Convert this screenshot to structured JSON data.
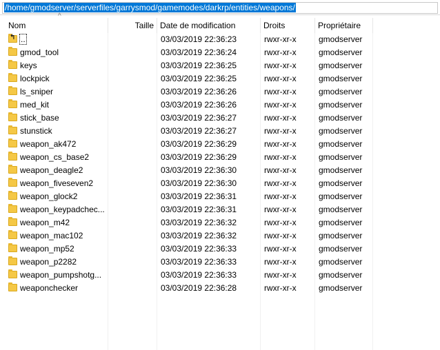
{
  "path_bar": {
    "value": "/home/gmodserver/serverfiles/garrysmod/gamemodes/darkrp/entities/weapons/"
  },
  "columns": {
    "name": "Nom",
    "size": "Taille",
    "date": "Date de modification",
    "permissions": "Droits",
    "owner": "Propriétaire"
  },
  "rows": [
    {
      "name": "..",
      "date": "03/03/2019 22:36:23",
      "permissions": "rwxr-xr-x",
      "owner": "gmodserver",
      "icon": "parent-folder-icon"
    },
    {
      "name": "gmod_tool",
      "date": "03/03/2019 22:36:24",
      "permissions": "rwxr-xr-x",
      "owner": "gmodserver",
      "icon": "folder-icon"
    },
    {
      "name": "keys",
      "date": "03/03/2019 22:36:25",
      "permissions": "rwxr-xr-x",
      "owner": "gmodserver",
      "icon": "folder-icon"
    },
    {
      "name": "lockpick",
      "date": "03/03/2019 22:36:25",
      "permissions": "rwxr-xr-x",
      "owner": "gmodserver",
      "icon": "folder-icon"
    },
    {
      "name": "ls_sniper",
      "date": "03/03/2019 22:36:26",
      "permissions": "rwxr-xr-x",
      "owner": "gmodserver",
      "icon": "folder-icon"
    },
    {
      "name": "med_kit",
      "date": "03/03/2019 22:36:26",
      "permissions": "rwxr-xr-x",
      "owner": "gmodserver",
      "icon": "folder-icon"
    },
    {
      "name": "stick_base",
      "date": "03/03/2019 22:36:27",
      "permissions": "rwxr-xr-x",
      "owner": "gmodserver",
      "icon": "folder-icon"
    },
    {
      "name": "stunstick",
      "date": "03/03/2019 22:36:27",
      "permissions": "rwxr-xr-x",
      "owner": "gmodserver",
      "icon": "folder-icon"
    },
    {
      "name": "weapon_ak472",
      "date": "03/03/2019 22:36:29",
      "permissions": "rwxr-xr-x",
      "owner": "gmodserver",
      "icon": "folder-icon"
    },
    {
      "name": "weapon_cs_base2",
      "date": "03/03/2019 22:36:29",
      "permissions": "rwxr-xr-x",
      "owner": "gmodserver",
      "icon": "folder-icon"
    },
    {
      "name": "weapon_deagle2",
      "date": "03/03/2019 22:36:30",
      "permissions": "rwxr-xr-x",
      "owner": "gmodserver",
      "icon": "folder-icon"
    },
    {
      "name": "weapon_fiveseven2",
      "date": "03/03/2019 22:36:30",
      "permissions": "rwxr-xr-x",
      "owner": "gmodserver",
      "icon": "folder-icon"
    },
    {
      "name": "weapon_glock2",
      "date": "03/03/2019 22:36:31",
      "permissions": "rwxr-xr-x",
      "owner": "gmodserver",
      "icon": "folder-icon"
    },
    {
      "name": "weapon_keypadchec...",
      "date": "03/03/2019 22:36:31",
      "permissions": "rwxr-xr-x",
      "owner": "gmodserver",
      "icon": "folder-icon"
    },
    {
      "name": "weapon_m42",
      "date": "03/03/2019 22:36:32",
      "permissions": "rwxr-xr-x",
      "owner": "gmodserver",
      "icon": "folder-icon"
    },
    {
      "name": "weapon_mac102",
      "date": "03/03/2019 22:36:32",
      "permissions": "rwxr-xr-x",
      "owner": "gmodserver",
      "icon": "folder-icon"
    },
    {
      "name": "weapon_mp52",
      "date": "03/03/2019 22:36:33",
      "permissions": "rwxr-xr-x",
      "owner": "gmodserver",
      "icon": "folder-icon"
    },
    {
      "name": "weapon_p2282",
      "date": "03/03/2019 22:36:33",
      "permissions": "rwxr-xr-x",
      "owner": "gmodserver",
      "icon": "folder-icon"
    },
    {
      "name": "weapon_pumpshotg...",
      "date": "03/03/2019 22:36:33",
      "permissions": "rwxr-xr-x",
      "owner": "gmodserver",
      "icon": "folder-icon"
    },
    {
      "name": "weaponchecker",
      "date": "03/03/2019 22:36:28",
      "permissions": "rwxr-xr-x",
      "owner": "gmodserver",
      "icon": "folder-icon"
    }
  ],
  "colors": {
    "selection": "#0078d7",
    "folder": "#f5c846"
  }
}
